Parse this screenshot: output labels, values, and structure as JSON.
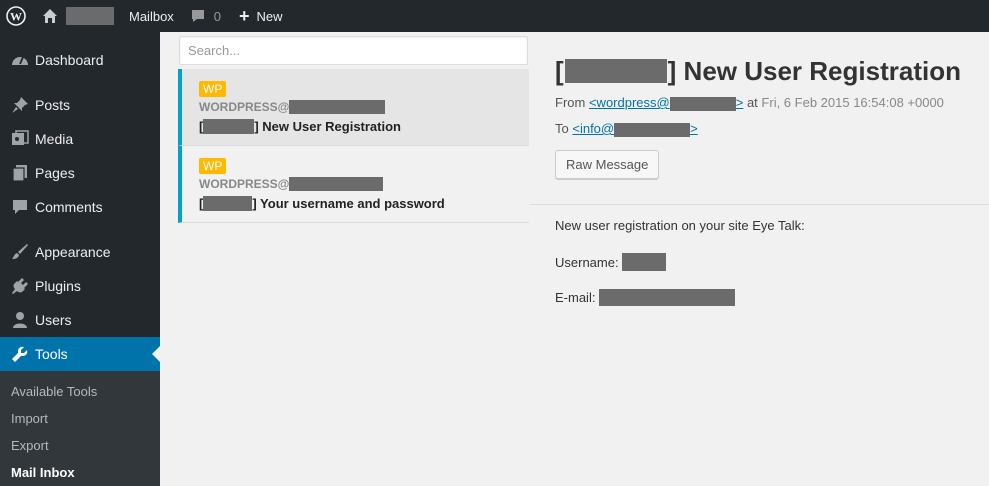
{
  "admin_bar": {
    "mailbox_label": "Mailbox",
    "comments_count": "0",
    "new_label": "New"
  },
  "sidebar": {
    "items": [
      {
        "label": "Dashboard",
        "icon": "dashboard-icon"
      },
      {
        "label": "Posts",
        "icon": "pin-icon"
      },
      {
        "label": "Media",
        "icon": "media-icon"
      },
      {
        "label": "Pages",
        "icon": "pages-icon"
      },
      {
        "label": "Comments",
        "icon": "comment-icon"
      },
      {
        "label": "Appearance",
        "icon": "brush-icon"
      },
      {
        "label": "Plugins",
        "icon": "plug-icon"
      },
      {
        "label": "Users",
        "icon": "user-icon"
      },
      {
        "label": "Tools",
        "icon": "wrench-icon"
      }
    ],
    "submenu": [
      "Available Tools",
      "Import",
      "Export",
      "Mail Inbox"
    ]
  },
  "search": {
    "placeholder": "Search..."
  },
  "messages": [
    {
      "badge": "WP",
      "sender": "WORDPRESS@",
      "subject_open": "[",
      "subject": "] New User Registration"
    },
    {
      "badge": "WP",
      "sender": "WORDPRESS@",
      "subject_open": "[",
      "subject": "] Your username and password"
    }
  ],
  "detail": {
    "title_open": "[",
    "title": "] New User Registration",
    "from_label": "From",
    "from_address": "<wordpress@",
    "from_address_end": ">",
    "at_label": "at",
    "date": "Fri, 6 Feb 2015 16:54:08 +0000",
    "to_label": "To",
    "to_address": "<info@",
    "to_address_end": ">",
    "raw_button": "Raw Message",
    "body_intro": "New user registration on your site Eye Talk:",
    "username_label": "Username:",
    "email_label": "E-mail:"
  },
  "colors": {
    "adminbar_bg": "#23282d",
    "active_menu": "#0073aa",
    "accent_border": "#00a0d2",
    "badge": "#ffb900",
    "link": "#0073aa"
  }
}
